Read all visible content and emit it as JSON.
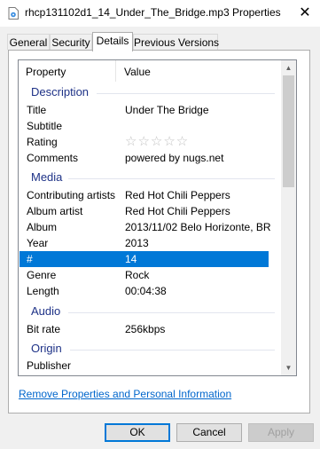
{
  "window": {
    "title": "rhcp131102d1_14_Under_The_Bridge.mp3 Properties",
    "close_glyph": "✕",
    "icon": "audio-file-icon"
  },
  "tabs": [
    {
      "label": "General",
      "active": false
    },
    {
      "label": "Security",
      "active": false
    },
    {
      "label": "Details",
      "active": true
    },
    {
      "label": "Previous Versions",
      "active": false
    }
  ],
  "details": {
    "columns": {
      "property": "Property",
      "value": "Value"
    },
    "groups": [
      {
        "label": "Description",
        "rows": [
          {
            "property": "Title",
            "value": "Under The Bridge"
          },
          {
            "property": "Subtitle",
            "value": ""
          },
          {
            "property": "Rating",
            "value": "☆☆☆☆☆"
          },
          {
            "property": "Comments",
            "value": "powered by nugs.net"
          }
        ]
      },
      {
        "label": "Media",
        "rows": [
          {
            "property": "Contributing artists",
            "value": "Red Hot Chili Peppers"
          },
          {
            "property": "Album artist",
            "value": "Red Hot Chili Peppers"
          },
          {
            "property": "Album",
            "value": "2013/11/02 Belo Horizonte, BR"
          },
          {
            "property": "Year",
            "value": "2013"
          },
          {
            "property": "#",
            "value": "14",
            "selected": true
          },
          {
            "property": "Genre",
            "value": "Rock"
          },
          {
            "property": "Length",
            "value": "00:04:38"
          }
        ]
      },
      {
        "label": "Audio",
        "rows": [
          {
            "property": "Bit rate",
            "value": "256kbps"
          }
        ]
      },
      {
        "label": "Origin",
        "rows": [
          {
            "property": "Publisher",
            "value": ""
          }
        ]
      }
    ]
  },
  "rating_stars": 0,
  "link_text": "Remove Properties and Personal Information",
  "buttons": {
    "ok": "OK",
    "cancel": "Cancel",
    "apply": "Apply"
  },
  "colors": {
    "selection": "#0078d7",
    "group_header": "#1e3287",
    "link": "#0066cc"
  }
}
